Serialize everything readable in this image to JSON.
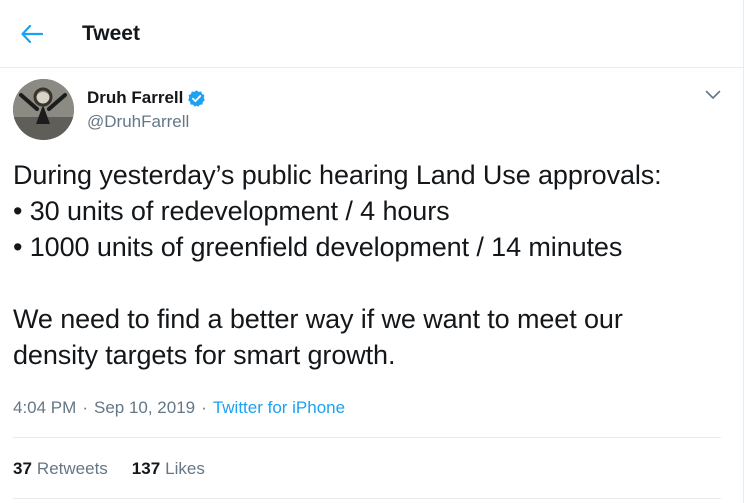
{
  "header": {
    "title": "Tweet",
    "back_icon": "arrow-left-icon"
  },
  "author": {
    "name": "Druh Farrell",
    "handle": "@DruhFarrell",
    "verified_icon": "verified-badge-icon"
  },
  "tweet": {
    "lines": [
      "During yesterday’s public hearing Land Use approvals:",
      "• 30 units of redevelopment / 4 hours",
      "• 1000 units of greenfield development / 14 minutes",
      "",
      "We need to find a better way if we want to meet our",
      "density targets for smart growth."
    ],
    "time": "4:04 PM",
    "date": "Sep 10, 2019",
    "source": "Twitter for iPhone",
    "separator": "·"
  },
  "stats": {
    "retweets_count": "37",
    "retweets_label": "Retweets",
    "likes_count": "137",
    "likes_label": "Likes"
  },
  "colors": {
    "accent": "#1da1f2",
    "text": "#14171a",
    "muted": "#657786",
    "divider": "#e6ecf0"
  }
}
